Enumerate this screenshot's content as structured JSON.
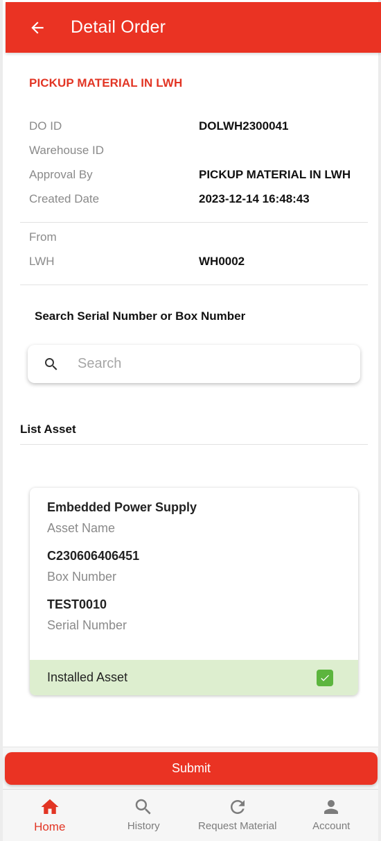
{
  "header": {
    "title": "Detail Order",
    "back_icon": "arrow-back-icon"
  },
  "order": {
    "section_title": "PICKUP MATERIAL IN LWH",
    "fields": [
      {
        "label": "DO ID",
        "value": "DOLWH2300041"
      },
      {
        "label": "Warehouse ID",
        "value": ""
      },
      {
        "label": "Approval By",
        "value": "PICKUP MATERIAL IN LWH"
      },
      {
        "label": "Created Date",
        "value": "2023-12-14 16:48:43"
      }
    ],
    "from": {
      "label": "From",
      "value": ""
    },
    "lwh": {
      "label": "LWH",
      "value": "WH0002"
    }
  },
  "search": {
    "label": "Search Serial Number or Box Number",
    "placeholder": "Search",
    "value": "",
    "icon": "search-icon"
  },
  "list": {
    "title": "List Asset",
    "assets": [
      {
        "name": "Embedded Power Supply",
        "name_label": "Asset Name",
        "box_number": "C230606406451",
        "box_label": "Box Number",
        "serial_number": "TEST0010",
        "serial_label": "Serial Number",
        "status_label": "Installed Asset",
        "checked": true
      }
    ]
  },
  "actions": {
    "submit_label": "Submit"
  },
  "bottom_nav": {
    "items": [
      {
        "label": "Home",
        "icon": "home-icon",
        "active": true
      },
      {
        "label": "History",
        "icon": "search-icon",
        "active": false
      },
      {
        "label": "Request Material",
        "icon": "refresh-icon",
        "active": false
      },
      {
        "label": "Account",
        "icon": "person-icon",
        "active": false
      }
    ]
  },
  "colors": {
    "primary": "#ea3323",
    "accent_text": "#e23524",
    "installed_bg": "#ddeecf",
    "check_green": "#5cb53e",
    "nav_inactive": "#7c7c7c"
  }
}
